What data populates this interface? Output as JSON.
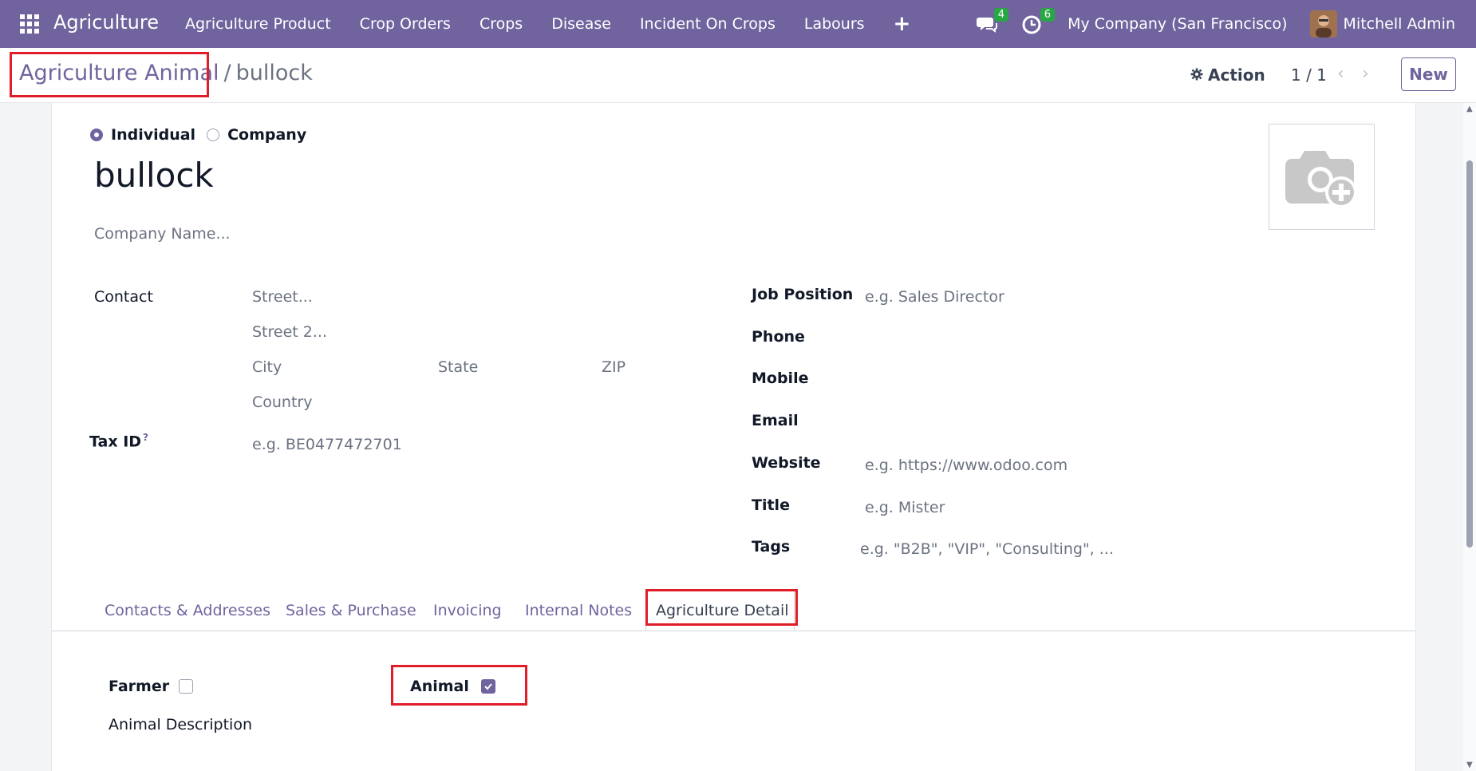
{
  "navbar": {
    "brand": "Agriculture",
    "menu": [
      "Agriculture Product",
      "Crop Orders",
      "Crops",
      "Disease",
      "Incident On Crops",
      "Labours"
    ],
    "plus": "+",
    "messages_count": "4",
    "activities_count": "6",
    "company": "My Company (San Francisco)",
    "user": "Mitchell Admin",
    "color": "#71639e"
  },
  "control_panel": {
    "breadcrumb_parent": "Agriculture Animal",
    "breadcrumb_sep": "/",
    "breadcrumb_current": "bullock",
    "action_label": "Action",
    "pager": "1 / 1",
    "new_label": "New"
  },
  "form": {
    "type_options": [
      "Individual",
      "Company"
    ],
    "selected_type": "Individual",
    "name": "bullock",
    "company_name_placeholder": "Company Name...",
    "contact_label": "Contact",
    "street_placeholder": "Street...",
    "street2_placeholder": "Street 2...",
    "city_placeholder": "City",
    "state_placeholder": "State",
    "zip_placeholder": "ZIP",
    "country_placeholder": "Country",
    "tax_id_label": "Tax ID",
    "tax_id_help": "?",
    "tax_id_placeholder": "e.g. BE0477472701",
    "job_position_label": "Job Position",
    "job_position_placeholder": "e.g. Sales Director",
    "phone_label": "Phone",
    "mobile_label": "Mobile",
    "email_label": "Email",
    "website_label": "Website",
    "website_placeholder": "e.g. https://www.odoo.com",
    "title_label": "Title",
    "title_placeholder": "e.g. Mister",
    "tags_label": "Tags",
    "tags_placeholder": "e.g. \"B2B\", \"VIP\", \"Consulting\", ..."
  },
  "tabs": [
    "Contacts & Addresses",
    "Sales & Purchase",
    "Invoicing",
    "Internal Notes",
    "Agriculture Detail"
  ],
  "active_tab": "Agriculture Detail",
  "agriculture_detail": {
    "farmer_label": "Farmer",
    "farmer_checked": false,
    "animal_label": "Animal",
    "animal_checked": true,
    "animal_description_label": "Animal Description"
  },
  "highlight_color": "#e11d2a"
}
